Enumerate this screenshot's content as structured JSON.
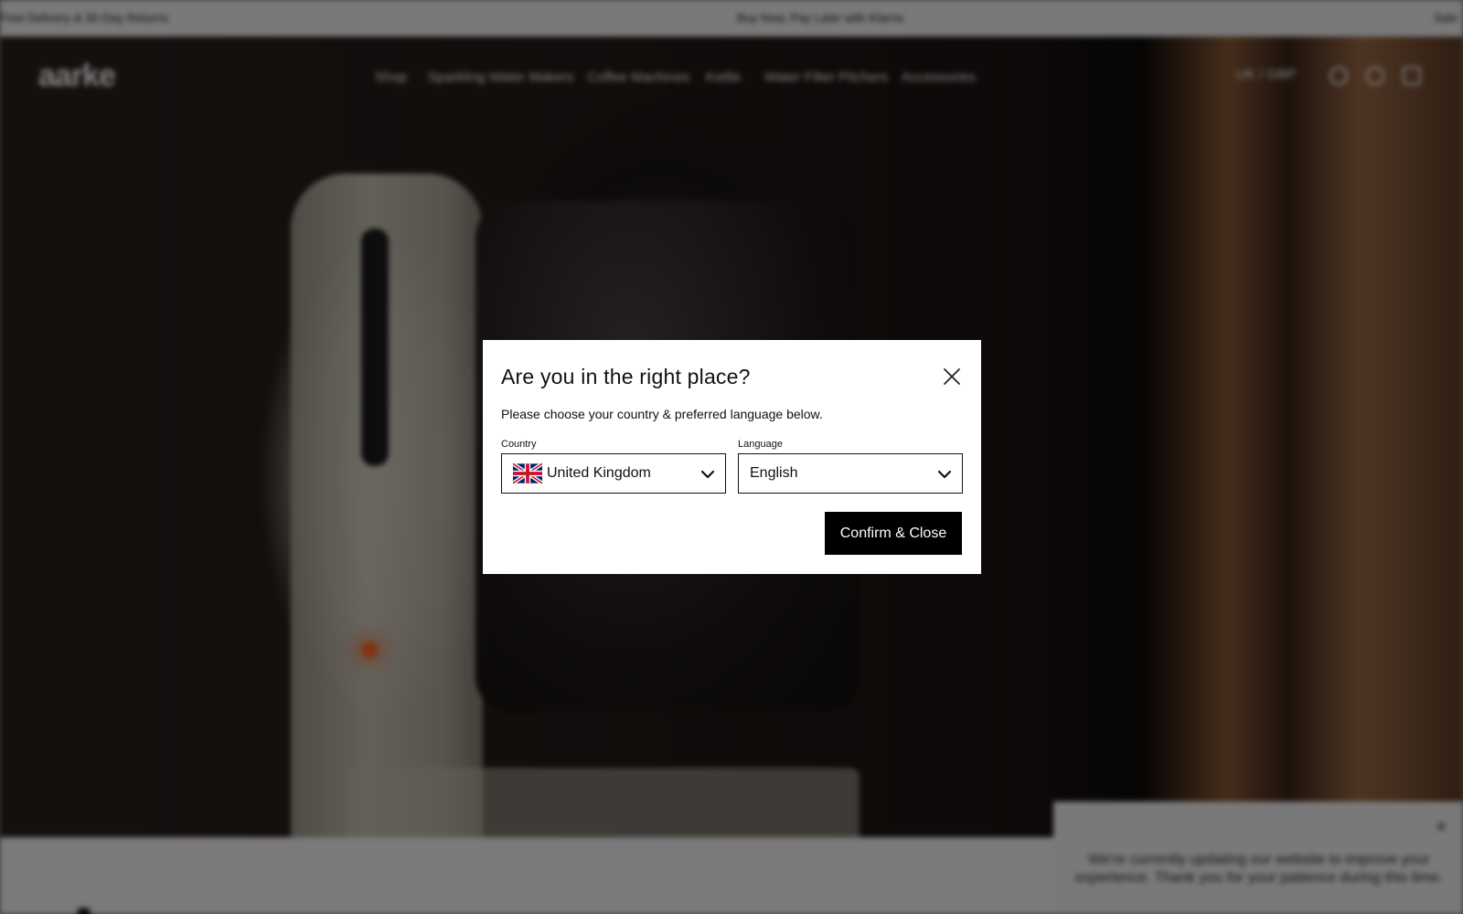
{
  "announcement_bar": {
    "left_text": "Free Delivery & 30-Day Returns",
    "center_text": "Buy Now, Pay Later with Klarna",
    "right_text": "Sale"
  },
  "header": {
    "logo_text": "aarke",
    "nav_items": [
      "Shop",
      "Sparkling Water Makers",
      "Coffee Machines",
      "Kettle",
      "Water Filter Pitchers",
      "Accessories"
    ],
    "locale_label": "UK / GBP",
    "icons": [
      "search-icon",
      "account-icon",
      "cart-icon"
    ]
  },
  "hero": {
    "image_description_name": "coffee-machine-hero"
  },
  "below_fold": {
    "heading_partial": "A"
  },
  "cookie_banner": {
    "close_symbol": "×",
    "text": "We're currently updating our website to improve your experience. Thank you for your patience during this time."
  },
  "modal": {
    "title": "Are you in the right place?",
    "description": "Please choose your country & preferred language below.",
    "country": {
      "label": "Country",
      "value": "United Kingdom",
      "flag_icon": "uk-flag-icon"
    },
    "language": {
      "label": "Language",
      "value": "English"
    },
    "confirm_label": "Confirm & Close"
  },
  "colors": {
    "overlay": "#000000",
    "modal_bg": "#ffffff",
    "button_bg": "#000000",
    "button_text": "#ffffff"
  }
}
